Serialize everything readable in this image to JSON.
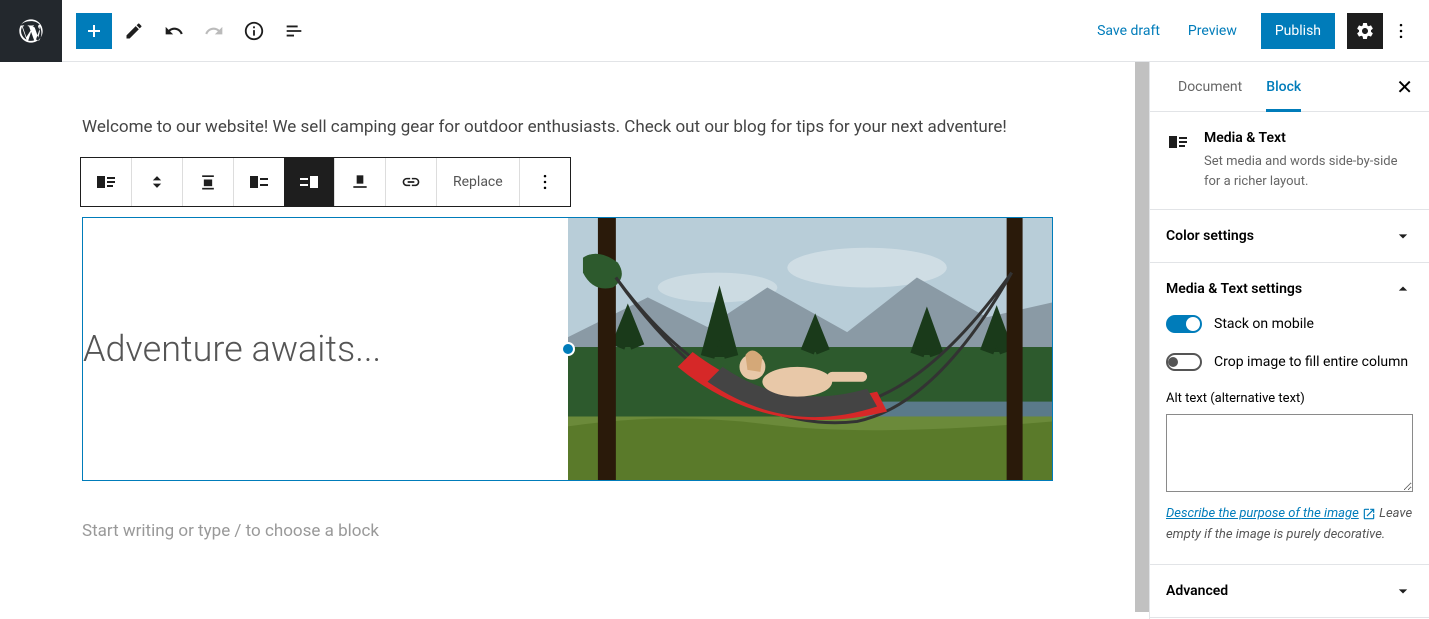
{
  "topbar": {
    "save_draft": "Save draft",
    "preview": "Preview",
    "publish": "Publish"
  },
  "editor": {
    "intro": "Welcome to our website! We sell camping gear for outdoor enthusiasts. Check out our blog for tips for your next adventure!",
    "media_text_heading": "Adventure awaits...",
    "placeholder": "Start writing or type / to choose a block",
    "replace_label": "Replace"
  },
  "sidebar": {
    "tabs": {
      "document": "Document",
      "block": "Block"
    },
    "block_info": {
      "title": "Media & Text",
      "desc": "Set media and words side-by-side for a richer layout."
    },
    "sections": {
      "color": "Color settings",
      "media_text": "Media & Text settings",
      "advanced": "Advanced"
    },
    "settings": {
      "stack_mobile": "Stack on mobile",
      "crop_fill": "Crop image to fill entire column",
      "alt_label": "Alt text (alternative text)",
      "describe_link": "Describe the purpose of the image",
      "helper_rest": " Leave empty if the image is purely decorative."
    }
  }
}
